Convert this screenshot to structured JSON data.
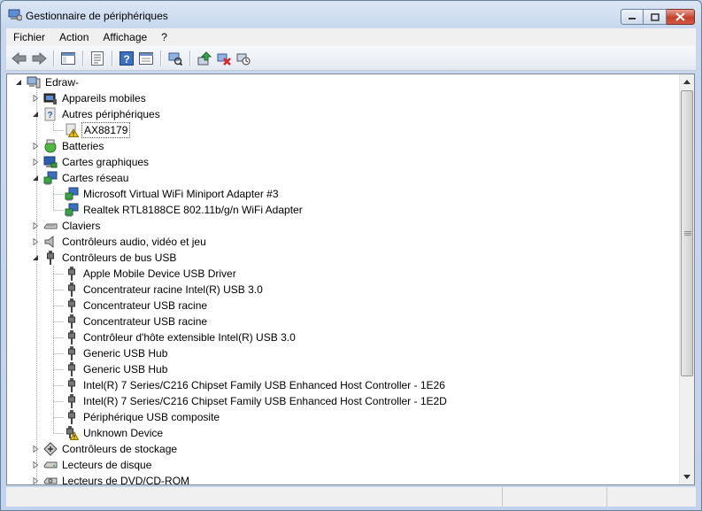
{
  "window": {
    "title": "Gestionnaire de périphériques",
    "controls": {
      "minimize": "—",
      "maximize": "▢",
      "close": "✕"
    }
  },
  "menu": [
    "Fichier",
    "Action",
    "Affichage",
    "?"
  ],
  "toolbar": {
    "buttons": [
      "back-icon",
      "forward-icon",
      "console-tree-icon",
      "properties-icon",
      "help-icon",
      "view-icon",
      "scan-hardware-icon",
      "update-driver-icon",
      "uninstall-icon",
      "disable-icon"
    ]
  },
  "tree": {
    "root": "Edraw-",
    "nodes": [
      {
        "label": "Appareils mobiles",
        "icon": "mobile-device-icon",
        "expanded": false
      },
      {
        "label": "Autres périphériques",
        "icon": "unknown-device-icon",
        "expanded": true
      },
      {
        "label": "AX88179",
        "icon": "warning-device-icon",
        "child": true,
        "selected": true
      },
      {
        "label": "Batteries",
        "icon": "battery-icon",
        "expanded": false
      },
      {
        "label": "Cartes graphiques",
        "icon": "display-adapter-icon",
        "expanded": false
      },
      {
        "label": "Cartes réseau",
        "icon": "network-adapter-icon",
        "expanded": true
      },
      {
        "label": "Microsoft Virtual WiFi Miniport Adapter #3",
        "icon": "network-adapter-icon",
        "child": true
      },
      {
        "label": "Realtek RTL8188CE 802.11b/g/n WiFi Adapter",
        "icon": "network-adapter-icon",
        "child": true
      },
      {
        "label": "Claviers",
        "icon": "keyboard-icon",
        "expanded": false
      },
      {
        "label": "Contrôleurs audio, vidéo et jeu",
        "icon": "speaker-icon",
        "expanded": false
      },
      {
        "label": "Contrôleurs de bus USB",
        "icon": "usb-icon",
        "expanded": true
      },
      {
        "label": "Apple Mobile Device USB Driver",
        "icon": "usb-icon",
        "child": true
      },
      {
        "label": "Concentrateur racine Intel(R) USB 3.0",
        "icon": "usb-icon",
        "child": true
      },
      {
        "label": "Concentrateur USB racine",
        "icon": "usb-icon",
        "child": true
      },
      {
        "label": "Concentrateur USB racine",
        "icon": "usb-icon",
        "child": true
      },
      {
        "label": "Contrôleur d'hôte extensible Intel(R) USB 3.0",
        "icon": "usb-icon",
        "child": true
      },
      {
        "label": "Generic USB Hub",
        "icon": "usb-icon",
        "child": true
      },
      {
        "label": "Generic USB Hub",
        "icon": "usb-icon",
        "child": true
      },
      {
        "label": "Intel(R) 7 Series/C216 Chipset Family USB Enhanced Host Controller - 1E26",
        "icon": "usb-icon",
        "child": true
      },
      {
        "label": "Intel(R) 7 Series/C216 Chipset Family USB Enhanced Host Controller - 1E2D",
        "icon": "usb-icon",
        "child": true
      },
      {
        "label": "Périphérique USB composite",
        "icon": "usb-icon",
        "child": true
      },
      {
        "label": "Unknown Device",
        "icon": "usb-warning-icon",
        "child": true
      },
      {
        "label": "Contrôleurs de stockage",
        "icon": "storage-controller-icon",
        "expanded": false
      },
      {
        "label": "Lecteurs de disque",
        "icon": "disk-drive-icon",
        "expanded": false
      },
      {
        "label": "Lecteurs de DVD/CD-ROM",
        "icon": "dvd-drive-icon",
        "expanded": false
      }
    ]
  }
}
